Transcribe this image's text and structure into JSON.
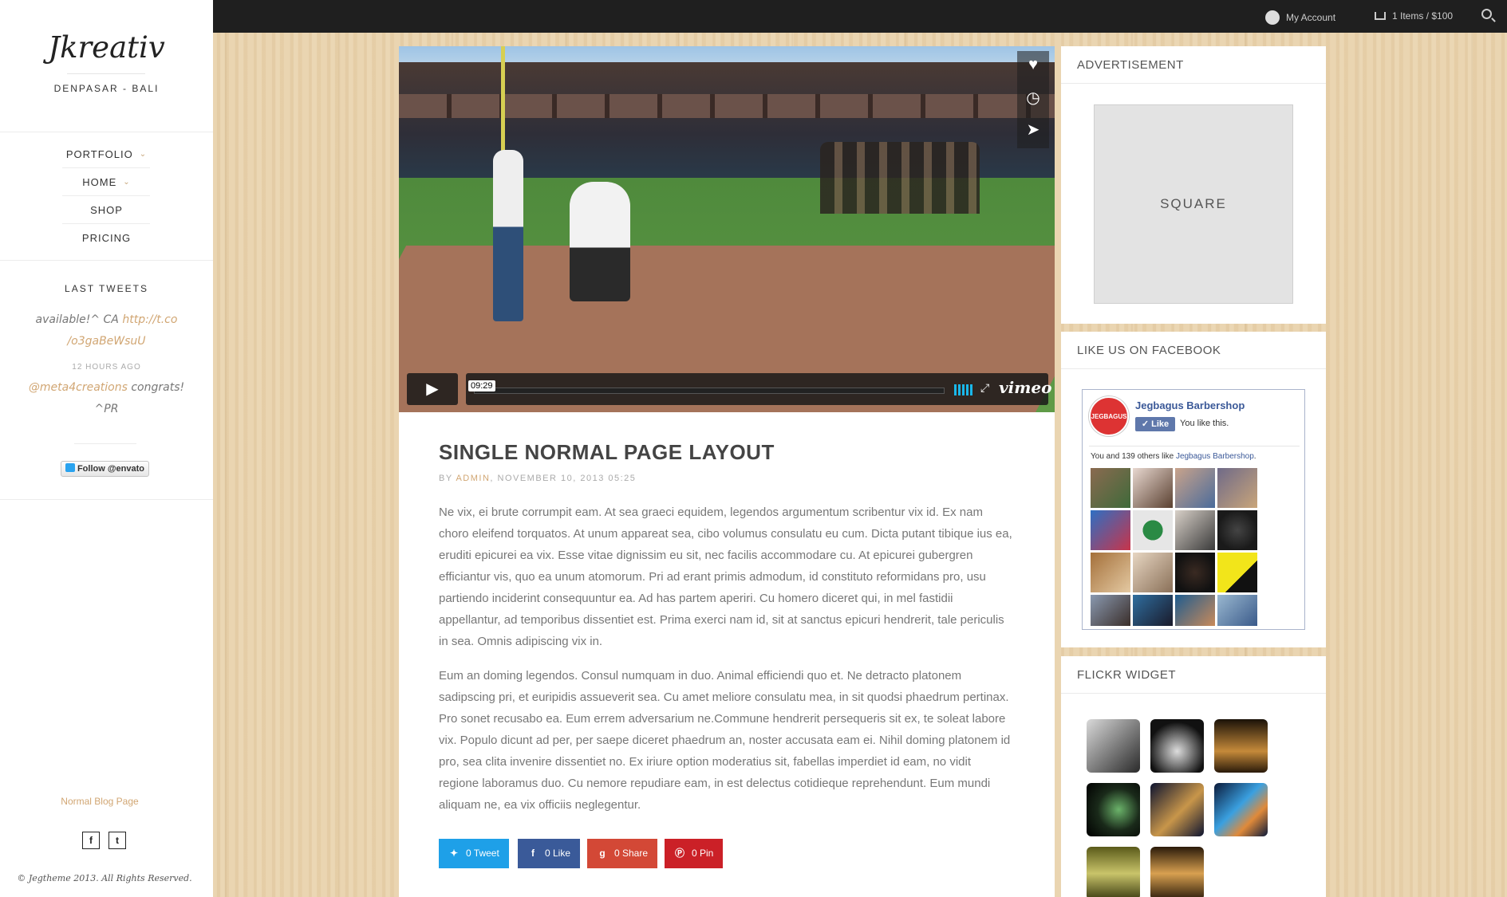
{
  "sidebar": {
    "logo": "Jkreativ",
    "tagline": "DENPASAR - BALI",
    "nav": [
      {
        "label": "PORTFOLIO",
        "has_submenu": true
      },
      {
        "label": "HOME",
        "has_submenu": true
      },
      {
        "label": "SHOP",
        "has_submenu": false
      },
      {
        "label": "PRICING",
        "has_submenu": false
      }
    ],
    "tweets_heading": "LAST TWEETS",
    "tweet1_text": "available!^ CA ",
    "tweet1_link": "http://t.co/o3gaBeWsuU",
    "tweet1_link_a": "http://t.co",
    "tweet1_link_b": "/o3gaBeWsuU",
    "tweet1_time": "12 HOURS AGO",
    "tweet2_handle": "@meta4creations",
    "tweet2_text": " congrats!",
    "tweet2_sig": "^PR",
    "follow_label": "Follow @envato",
    "footer_link": "Normal Blog Page",
    "social": [
      "f",
      "t"
    ],
    "social_icons": [
      "facebook-icon",
      "twitter-icon"
    ],
    "copyright": "© Jegtheme 2013. All Rights Reserved."
  },
  "topbar": {
    "account_label": "My Account",
    "cart_label": "1 Items / $100"
  },
  "video": {
    "timecode": "09:29",
    "provider": "vimeo",
    "side_icons": [
      "heart-icon",
      "clock-icon",
      "send-icon"
    ]
  },
  "post": {
    "title": "SINGLE NORMAL PAGE LAYOUT",
    "meta_prefix": "BY ",
    "author": "ADMIN",
    "meta_date": ", NOVEMBER 10, 2013 05:25",
    "paragraph1": "Ne vix, ei brute corrumpit eam. At sea graeci equidem, legendos argumentum scribentur vix id. Ex nam choro eleifend torquatos. At unum appareat sea, cibo volumus consulatu eu cum. Dicta putant tibique ius ea, eruditi epicurei ea vix. Esse vitae dignissim eu sit, nec facilis accommodare cu. At epicurei gubergren efficiantur vis, quo ea unum atomorum. Pri ad erant primis admodum, id constituto reformidans pro, usu partiendo inciderint consequuntur ea. Ad has partem aperiri. Cu homero diceret qui, in mel fastidii appellantur, ad temporibus dissentiet est. Prima exerci nam id, sit at sanctus epicuri hendrerit, tale periculis in sea. Omnis adipiscing vix in.",
    "paragraph2": "Eum an doming legendos. Consul numquam in duo. Animal efficiendi quo et. Ne detracto platonem sadipscing pri, et euripidis assueverit sea. Cu amet meliore consulatu mea, in sit quodsi phaedrum pertinax. Pro sonet recusabo ea. Eum errem adversarium ne.Commune hendrerit persequeris sit ex, te soleat labore vix. Populo dicunt ad per, per saepe diceret phaedrum an, noster accusata eam ei. Nihil doming platonem id pro, sea clita invenire dissentiet no. Ex iriure option moderatius sit, fabellas imperdiet id eam, no vidit regione laboramus duo. Cu nemore repudiare eam, in est delectus cotidieque reprehendunt. Eum mundi aliquam ne, ea vix officiis neglegentur.",
    "share": [
      {
        "label": "0 Tweet",
        "icon": "twitter-icon",
        "color": "#1ea0e8"
      },
      {
        "label": "0 Like",
        "icon": "facebook-icon",
        "color": "#3a5a99"
      },
      {
        "label": "0 Share",
        "icon": "google-plus-icon",
        "color": "#d34836"
      },
      {
        "label": "0 Pin",
        "icon": "pinterest-icon",
        "color": "#cb2027"
      }
    ]
  },
  "widgets": {
    "advertisement_title": "ADVERTISEMENT",
    "ad_label": "SQUARE",
    "facebook_title": "LIKE US ON FACEBOOK",
    "fb_page_name": "Jegbagus Barbershop",
    "fb_logo_text": "JEGBAGUS",
    "fb_like_label": "Like",
    "fb_you_like": "You like this.",
    "fb_others_prefix": "You and 139 others like ",
    "fb_others_page": "Jegbagus Barbershop",
    "fb_others_suffix": ".",
    "flickr_title": "FLICKR WIDGET"
  },
  "colors": {
    "accent": "#d1a673",
    "topbar": "#1f1f1f",
    "wood": "#e9d2ac"
  }
}
